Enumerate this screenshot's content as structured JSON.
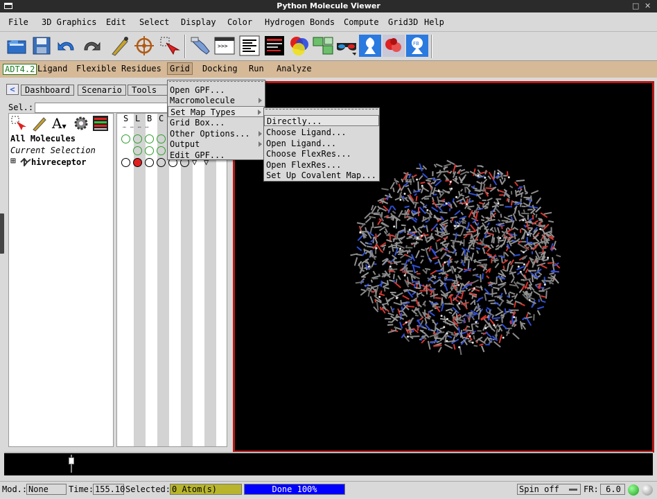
{
  "window": {
    "title": "Python Molecule Viewer"
  },
  "menubar": [
    "File",
    "3D Graphics",
    "Edit",
    "Select",
    "Display",
    "Color",
    "Hydrogen Bonds",
    "Compute",
    "Grid3D",
    "Help"
  ],
  "toolbar_icons": [
    "open-icon",
    "save-icon",
    "undo-icon",
    "redo-icon",
    "pick-icon",
    "center-icon",
    "select-icon",
    "hand-icon",
    "python-shell-icon",
    "text-icon",
    "dashboard-icon",
    "color-icon",
    "split-icon",
    "stereo-glasses-icon",
    "autodock-icon",
    "molecule-red-icon",
    "fb-icon"
  ],
  "adt": {
    "badge": "ADT4.2",
    "menus": [
      "Ligand",
      "Flexible Residues",
      "Grid",
      "Docking",
      "Run",
      "Analyze"
    ]
  },
  "left_panel": {
    "tabs": [
      "Dashboard",
      "Scenario",
      "Tools"
    ],
    "sel_label": "Sel.:",
    "column_headers": [
      "S",
      "L",
      "B",
      "C"
    ],
    "rows": [
      {
        "label": "All Molecules",
        "style": "bold"
      },
      {
        "label": "Current Selection",
        "style": "italic"
      },
      {
        "label": "hivreceptor",
        "style": "bold",
        "expander": "⊞"
      }
    ]
  },
  "grid_menu": {
    "items": [
      "Open GPF...",
      "Macromolecule",
      "Set Map Types",
      "Grid Box...",
      "Other Options...",
      "Output",
      "Edit GPF..."
    ],
    "submenu_items": [
      "Directly...",
      "Choose Ligand...",
      "Open Ligand...",
      "Choose FlexRes...",
      "Open FlexRes...",
      "Set Up Covalent Map..."
    ]
  },
  "status": {
    "mod_label": "Mod.:",
    "mod_value": "None",
    "time_label": "Time:",
    "time_value": "155.10",
    "selected_label": "Selected:",
    "selected_value": "0 Atom(s)",
    "progress_text": "Done 100%",
    "progress_fraction": 1.0,
    "spin_value": "Spin off",
    "fr_label": "FR:",
    "fr_value": "6.0"
  },
  "colors": {
    "adt_bar": "#d6b997",
    "viewer_border": "#b41818",
    "selected_field": "#b8b52c",
    "progress": "#0000ff"
  }
}
